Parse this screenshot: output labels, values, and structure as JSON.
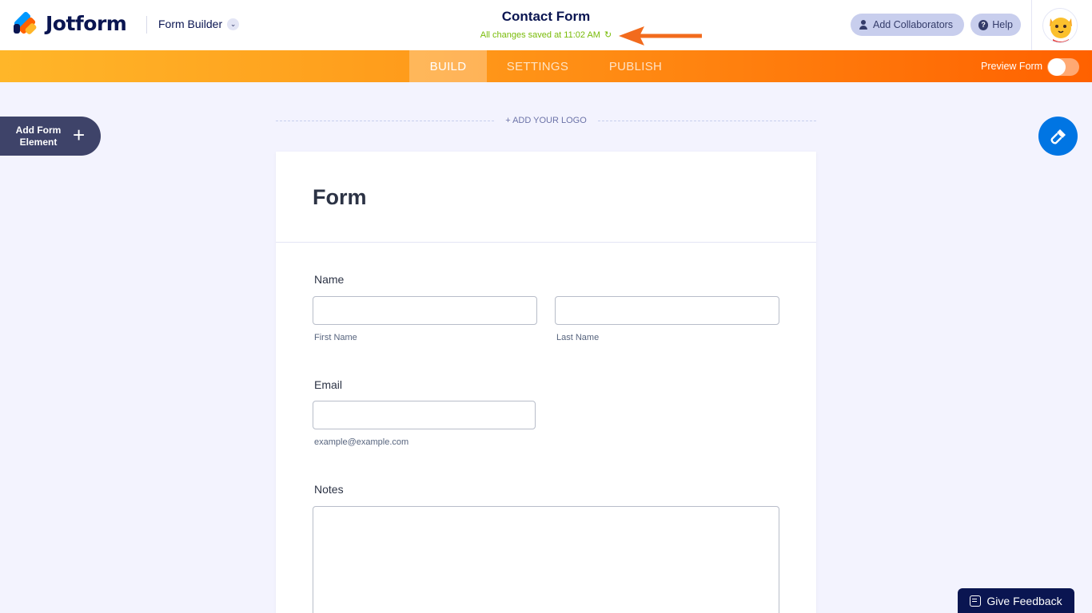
{
  "header": {
    "brand": "Jotform",
    "builder_menu": "Form Builder",
    "form_title": "Contact Form",
    "save_status": "All changes saved at 11:02 AM",
    "add_collaborators": "Add Collaborators",
    "help": "Help"
  },
  "nav": {
    "tabs": [
      {
        "label": "BUILD",
        "active": true
      },
      {
        "label": "SETTINGS",
        "active": false
      },
      {
        "label": "PUBLISH",
        "active": false
      }
    ],
    "preview_label": "Preview Form",
    "preview_on": false
  },
  "sidebar": {
    "add_element_line1": "Add Form",
    "add_element_line2": "Element"
  },
  "logo_area": {
    "add_logo": "+ ADD YOUR LOGO"
  },
  "form": {
    "heading": "Form",
    "fields": {
      "name": {
        "label": "Name",
        "first_value": "",
        "first_sublabel": "First Name",
        "last_value": "",
        "last_sublabel": "Last Name"
      },
      "email": {
        "label": "Email",
        "value": "",
        "sublabel": "example@example.com"
      },
      "notes": {
        "label": "Notes",
        "value": ""
      }
    }
  },
  "feedback": {
    "label": "Give Feedback"
  },
  "colors": {
    "accent_orange": "#ff6100",
    "brand_navy": "#0a1551",
    "save_green": "#78bb07",
    "designer_blue": "#0075e3"
  }
}
